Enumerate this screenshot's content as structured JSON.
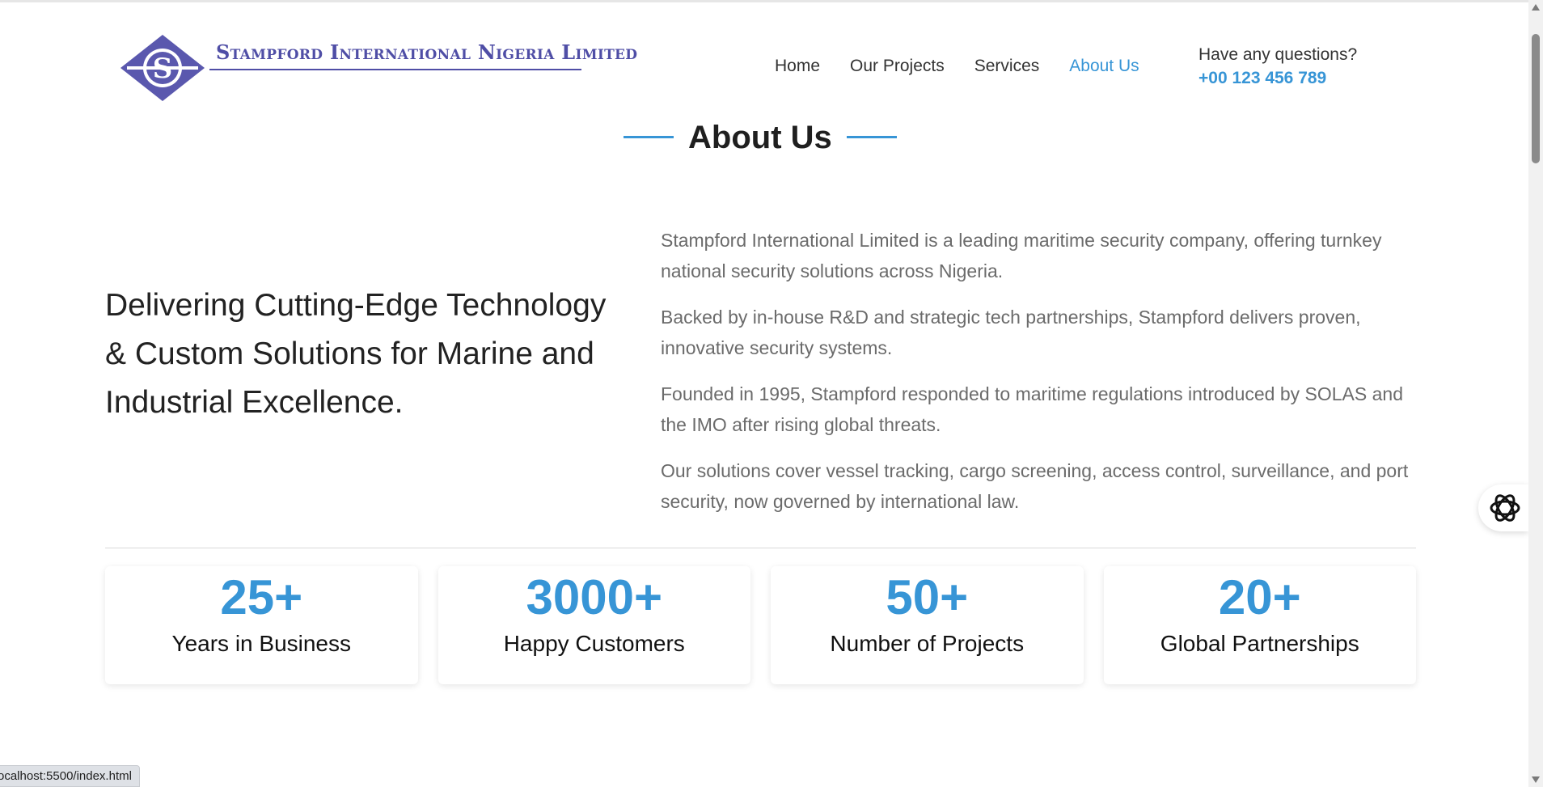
{
  "brand": {
    "name": "Stampford International Nigeria Limited",
    "logo_letter": "S",
    "primary_color": "#4f4ea6",
    "accent_color": "#3795d6"
  },
  "nav": {
    "items": [
      {
        "label": "Home",
        "active": false
      },
      {
        "label": "Our Projects",
        "active": false
      },
      {
        "label": "Services",
        "active": false
      },
      {
        "label": "About Us",
        "active": true
      }
    ]
  },
  "contact": {
    "question": "Have any questions?",
    "phone": "+00 123 456 789"
  },
  "about": {
    "heading": "About Us",
    "tagline": "Delivering Cutting-Edge Technology & Custom Solutions for Marine and Industrial Excellence.",
    "paragraphs": [
      "Stampford International Limited is a leading maritime security company, offering turnkey national security solutions across Nigeria.",
      "Backed by in-house R&D and strategic tech partnerships, Stampford delivers proven, innovative security systems.",
      "Founded in 1995, Stampford responded to maritime regulations introduced by SOLAS and the IMO after rising global threats.",
      "Our solutions cover vessel tracking, cargo screening, access control, surveillance, and port security, now governed by international law."
    ]
  },
  "stats": [
    {
      "value": "25+",
      "label": "Years in Business"
    },
    {
      "value": "3000+",
      "label": "Happy Customers"
    },
    {
      "value": "50+",
      "label": "Number of Projects"
    },
    {
      "value": "20+",
      "label": "Global Partnerships"
    }
  ],
  "widget": {
    "icon": "ai-assistant-icon"
  },
  "statusbar": {
    "url": "ocalhost:5500/index.html"
  }
}
